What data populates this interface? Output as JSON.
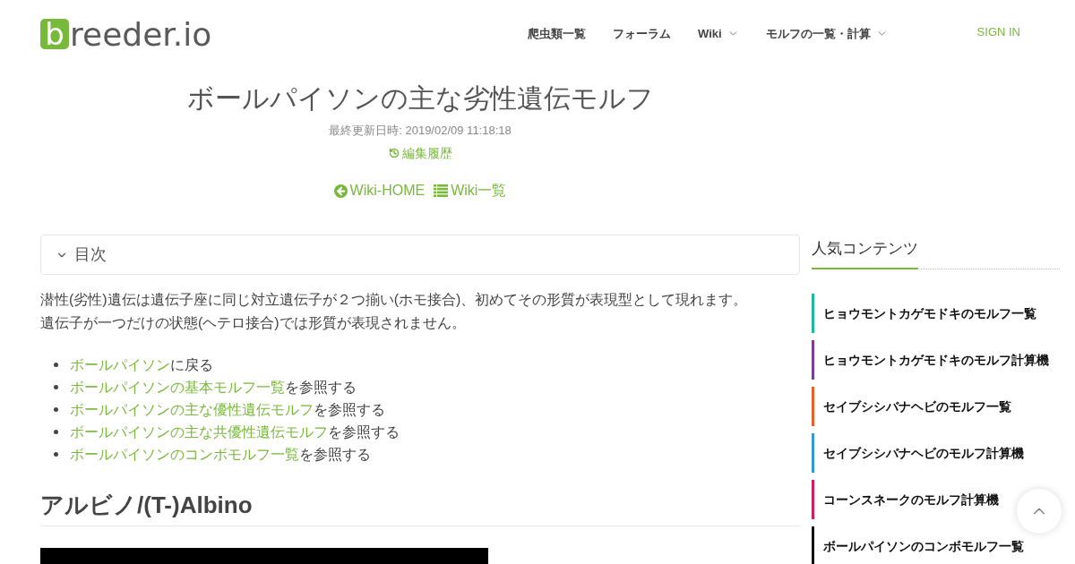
{
  "header": {
    "logo": {
      "initial": "b",
      "rest": "reeder.io"
    },
    "nav": [
      {
        "label": "爬虫類一覧",
        "dropdown": false
      },
      {
        "label": "フォーラム",
        "dropdown": false
      },
      {
        "label": "Wiki",
        "dropdown": true
      },
      {
        "label": "モルフの一覧・計算",
        "dropdown": true
      }
    ],
    "sign_in": "SIGN IN"
  },
  "page": {
    "title": "ボールパイソンの主な劣性遺伝モルフ",
    "updated": "最終更新日時: 2019/02/09 11:18:18",
    "history_link": "編集履歴",
    "wiki_links": [
      {
        "kind": "home",
        "label": "Wiki-HOME"
      },
      {
        "kind": "list",
        "label": "Wiki一覧"
      }
    ]
  },
  "toc": {
    "label": "目次"
  },
  "intro": {
    "lines": [
      "潜性(劣性)遺伝は遺伝子座に同じ対立遺伝子が２つ揃い(ホモ接合)、初めてその形質が表現型として現れます。",
      "遺伝子が一つだけの状態(ヘテロ接合)では形質が表現されません。"
    ]
  },
  "links": [
    {
      "link": "ボールパイソン",
      "suffix": "に戻る"
    },
    {
      "link": "ボールパイソンの基本モルフ一覧",
      "suffix": "を参照する"
    },
    {
      "link": "ボールパイソンの主な優性遺伝モルフ",
      "suffix": "を参照する"
    },
    {
      "link": "ボールパイソンの主な共優性遺伝モルフ",
      "suffix": "を参照する"
    },
    {
      "link": "ボールパイソンのコンボモルフ一覧",
      "suffix": "を参照する"
    }
  ],
  "section_heading": "アルビノ/(T-)Albino",
  "sidebar": {
    "title": "人気コンテンツ",
    "items": [
      {
        "label": "ヒョウモントカゲモドキのモルフ一覧",
        "color": "#1abc9c"
      },
      {
        "label": "ヒョウモントカゲモドキのモルフ計算機",
        "color": "#7d3c98"
      },
      {
        "label": "セイブシシバナヘビのモルフ一覧",
        "color": "#e8602c"
      },
      {
        "label": "セイブシシバナヘビのモルフ計算機",
        "color": "#3498db"
      },
      {
        "label": "コーンスネークのモルフ計算機",
        "color": "#d81b60"
      },
      {
        "label": "ボールパイソンのコンボモルフ一覧",
        "color": "#111111"
      }
    ]
  }
}
